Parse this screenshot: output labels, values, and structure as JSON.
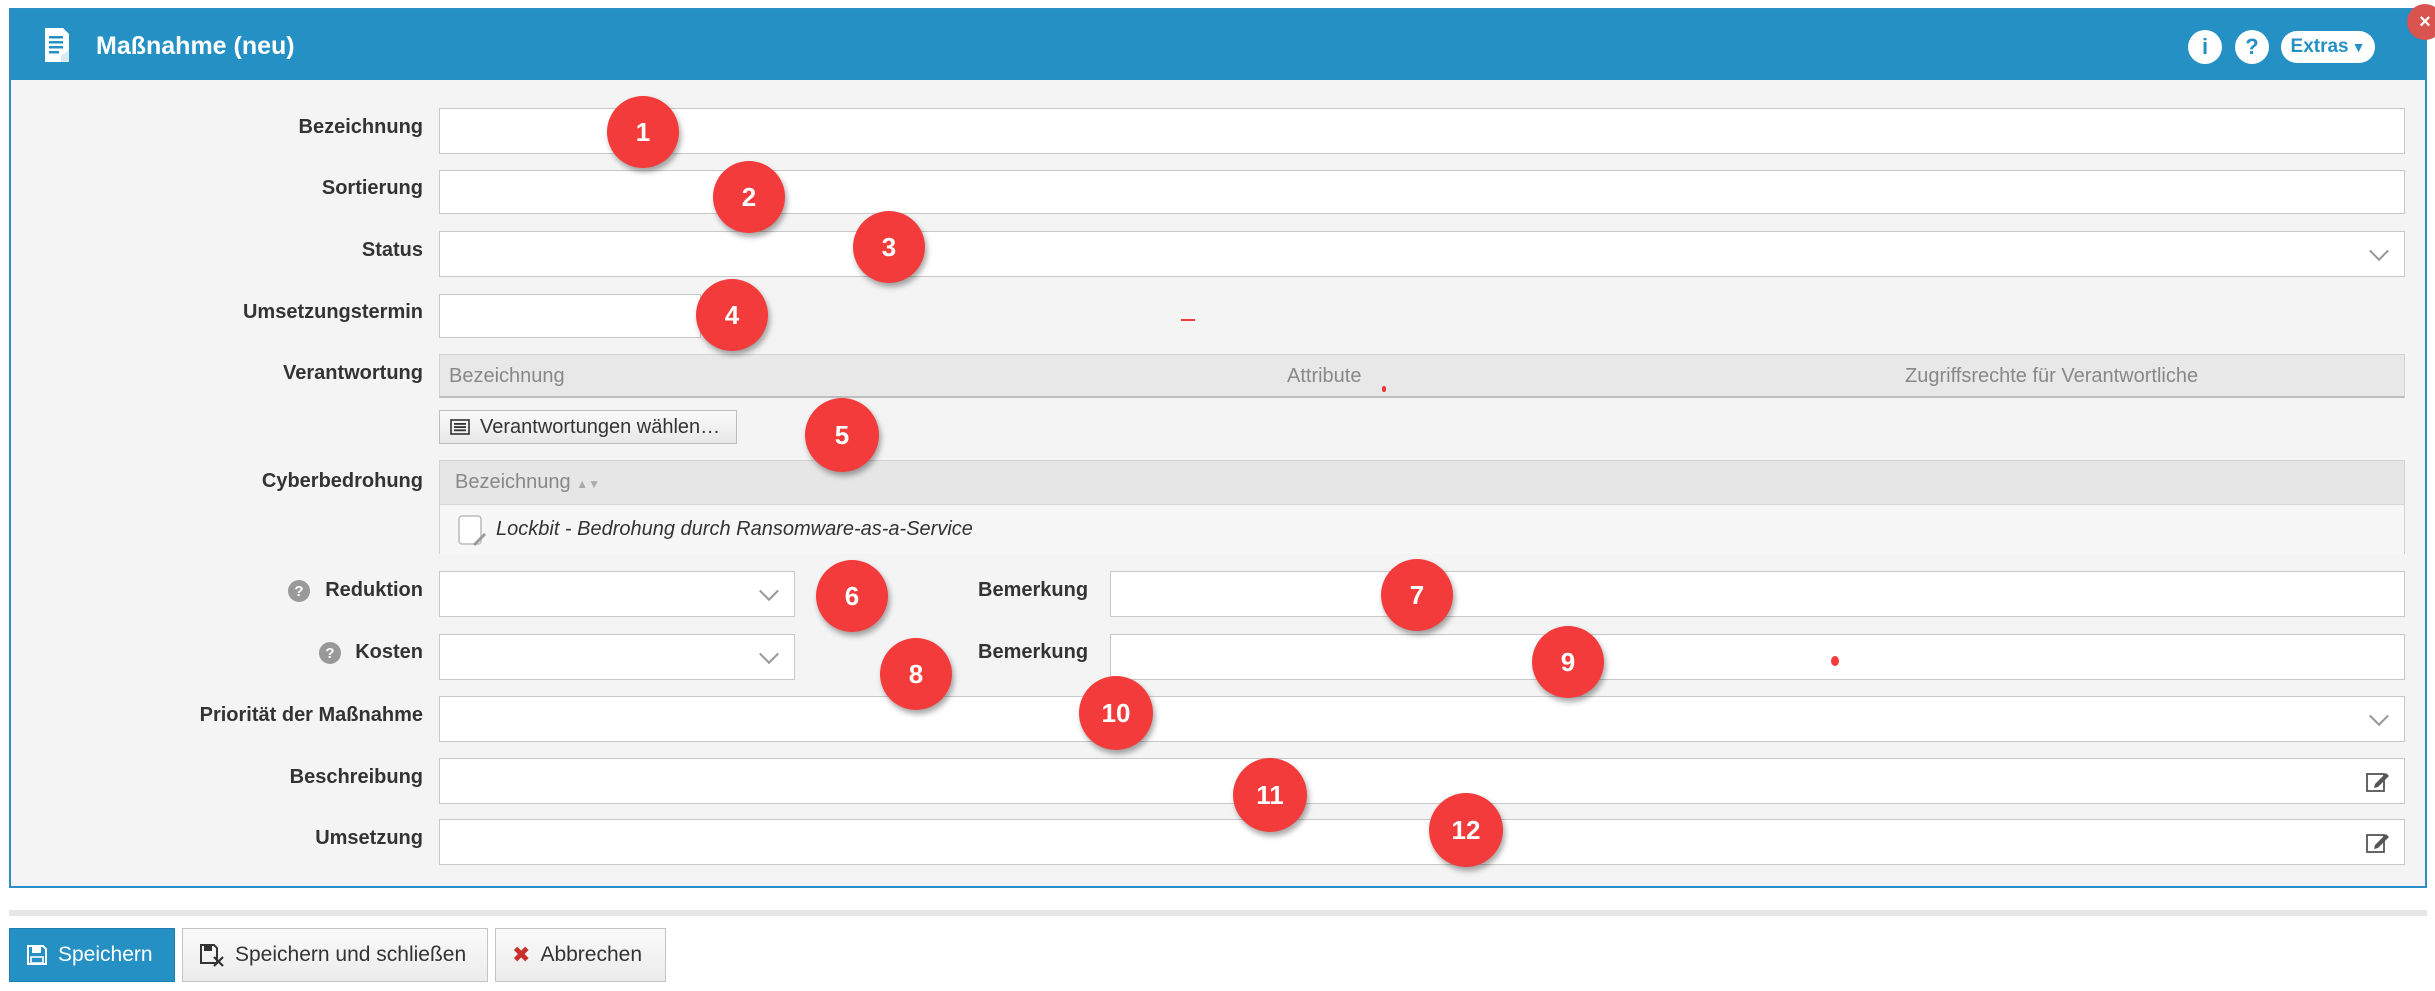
{
  "window": {
    "title": "Maßnahme (neu)",
    "info_button": "i",
    "help_button": "?",
    "extras_label": "Extras",
    "close_label": "×"
  },
  "form": {
    "bezeichnung": {
      "label": "Bezeichnung",
      "value": ""
    },
    "sortierung": {
      "label": "Sortierung",
      "value": ""
    },
    "status": {
      "label": "Status",
      "value": ""
    },
    "umsetzungstermin": {
      "label": "Umsetzungstermin",
      "value": ""
    },
    "verantwortung": {
      "label": "Verantwortung",
      "columns": [
        "Bezeichnung",
        "Attribute",
        "Zugriffsrechte für Verantwortliche"
      ],
      "choose_button": "Verantwortungen wählen…"
    },
    "cyberbedrohung": {
      "label": "Cyberbedrohung",
      "column": "Bezeichnung",
      "rows": [
        "Lockbit - Bedrohung durch Ransomware-as-a-Service"
      ]
    },
    "reduktion": {
      "label": "Reduktion",
      "value": "",
      "help": "?"
    },
    "reduktion_bemerkung": {
      "label": "Bemerkung",
      "value": ""
    },
    "kosten": {
      "label": "Kosten",
      "value": "",
      "help": "?"
    },
    "kosten_bemerkung": {
      "label": "Bemerkung",
      "value": ""
    },
    "prioritaet": {
      "label": "Priorität der Maßnahme",
      "value": ""
    },
    "beschreibung": {
      "label": "Beschreibung",
      "value": ""
    },
    "umsetzung": {
      "label": "Umsetzung",
      "value": ""
    }
  },
  "markers": [
    "1",
    "2",
    "3",
    "4",
    "5",
    "6",
    "7",
    "8",
    "9",
    "10",
    "11",
    "12"
  ],
  "footer": {
    "save": "Speichern",
    "save_close": "Speichern und schließen",
    "cancel": "Abbrechen"
  },
  "colors": {
    "titlebar": "#2490c4",
    "marker": "#f33b3b",
    "cancel_icon": "#c9302c"
  }
}
